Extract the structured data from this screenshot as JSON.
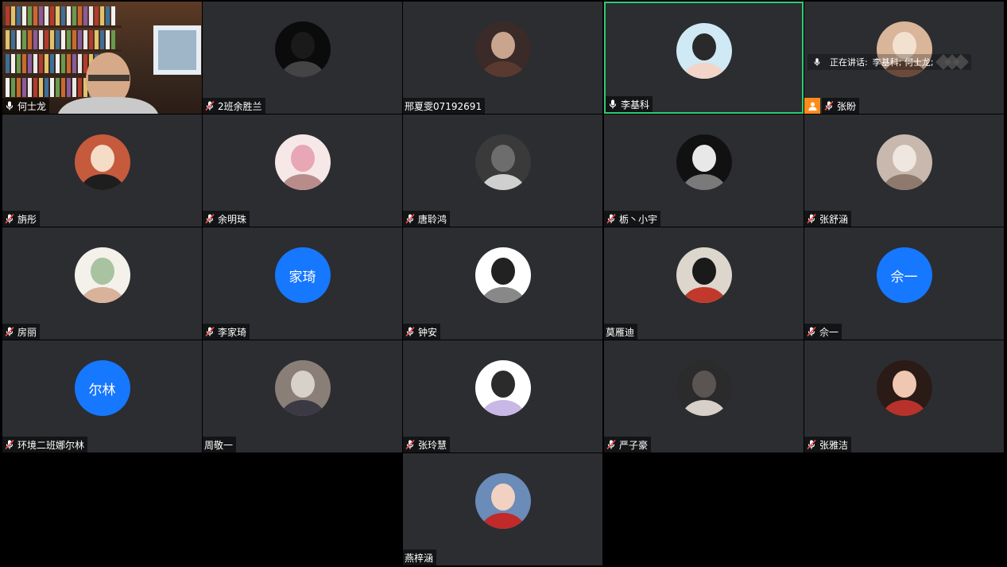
{
  "speaking": {
    "label": "正在讲话:",
    "speakers": "李基科; 何士龙;"
  },
  "participants": [
    {
      "name": "何士龙",
      "type": "video",
      "mic": "on"
    },
    {
      "name": "2班余胜兰",
      "type": "avatar",
      "mic": "muted"
    },
    {
      "name": "邢夏雯07192691",
      "type": "avatar",
      "mic": "none"
    },
    {
      "name": "李基科",
      "type": "avatar",
      "mic": "on",
      "active": true
    },
    {
      "name": "张盼",
      "type": "avatar",
      "mic": "muted",
      "presenter": true
    },
    {
      "name": "旃彤",
      "type": "avatar",
      "mic": "muted"
    },
    {
      "name": "余明珠",
      "type": "avatar",
      "mic": "muted"
    },
    {
      "name": "唐聆鸿",
      "type": "avatar",
      "mic": "muted"
    },
    {
      "name": "栃丶小宇",
      "type": "avatar",
      "mic": "muted"
    },
    {
      "name": "张舒涵",
      "type": "avatar",
      "mic": "muted"
    },
    {
      "name": "房丽",
      "type": "avatar",
      "mic": "muted"
    },
    {
      "name": "李家琦",
      "type": "initials",
      "initials": "家琦",
      "mic": "muted"
    },
    {
      "name": "钟安",
      "type": "avatar",
      "mic": "muted"
    },
    {
      "name": "莫雁迪",
      "type": "avatar",
      "mic": "none"
    },
    {
      "name": "佘一",
      "type": "initials",
      "initials": "佘一",
      "mic": "muted"
    },
    {
      "name": "环境二班娜尔林",
      "type": "initials",
      "initials": "尔林",
      "mic": "muted"
    },
    {
      "name": "周敬一",
      "type": "avatar",
      "mic": "none"
    },
    {
      "name": "张玲慧",
      "type": "avatar",
      "mic": "muted"
    },
    {
      "name": "严子豪",
      "type": "avatar",
      "mic": "muted"
    },
    {
      "name": "张雅洁",
      "type": "avatar",
      "mic": "muted"
    },
    {
      "name": "燕梓涵",
      "type": "avatar",
      "mic": "none"
    }
  ],
  "colors": {
    "tile_bg": "#2b2d31",
    "active_border": "#2ecc71",
    "initials_bg": "#1677ff",
    "presenter_badge": "#ff8c1a",
    "muted_slash": "#ff4d4f"
  },
  "avatar_palettes": [
    [
      "#7a3b2e",
      "#e6b8a0",
      "#2b2b2b"
    ],
    [
      "#0b0b0b",
      "#1a1a1a",
      "#444"
    ],
    [
      "#3a2a28",
      "#c9a48e",
      "#5a3a30"
    ],
    [
      "#cfe9f5",
      "#2a2a2a",
      "#f2d5c8"
    ],
    [
      "#d9b59a",
      "#f3e1cf",
      "#6b4a3a"
    ],
    [
      "#c65a3d",
      "#f4dcc6",
      "#1e1e1e"
    ],
    [
      "#f7e8e8",
      "#e7a7b4",
      "#b98c8c"
    ],
    [
      "#3a3a3a",
      "#6d6d6d",
      "#cfcfcf"
    ],
    [
      "#111111",
      "#e8e8e8",
      "#7a7a7a"
    ],
    [
      "#c9b8ad",
      "#efe6df",
      "#8d7a6c"
    ],
    [
      "#f4f1ea",
      "#a9c3a0",
      "#d9b29a"
    ],
    [
      "#1677ff",
      "#1677ff",
      "#1677ff"
    ],
    [
      "#ffffff",
      "#222222",
      "#888888"
    ],
    [
      "#dcd6cc",
      "#1a1a1a",
      "#c0392b"
    ],
    [
      "#1677ff",
      "#1677ff",
      "#1677ff"
    ],
    [
      "#1677ff",
      "#1677ff",
      "#1677ff"
    ],
    [
      "#8a7f76",
      "#d8d1ca",
      "#3b3a44"
    ],
    [
      "#ffffff",
      "#2b2b2b",
      "#c9b7e6"
    ],
    [
      "#2b2b2b",
      "#5a5552",
      "#d6d0c8"
    ],
    [
      "#2a1b17",
      "#f0c7b0",
      "#b8322c"
    ],
    [
      "#6b8bb8",
      "#f1d1c2",
      "#c02a2a"
    ]
  ]
}
